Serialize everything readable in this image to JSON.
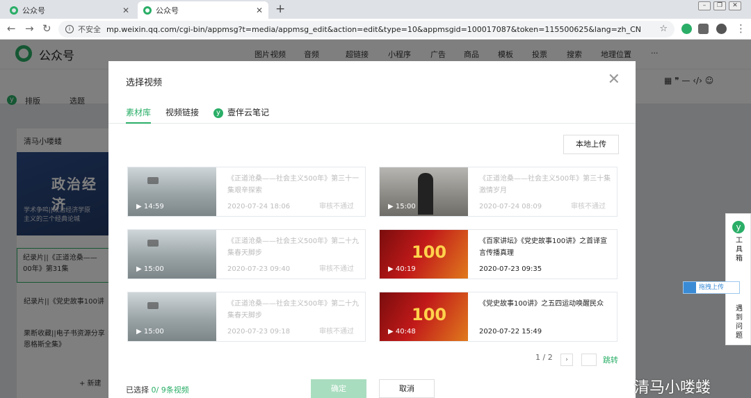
{
  "browser": {
    "tabs": [
      {
        "label": "公众号",
        "close": "✕"
      },
      {
        "label": "公众号",
        "close": "✕"
      }
    ],
    "new_tab": "+",
    "address": {
      "insecure": "不安全",
      "url": "mp.weixin.qq.com/cgi-bin/appmsg?t=media/appmsg_edit&action=edit&type=10&appmsgid=100017087&token=115500625&lang=zh_CN"
    }
  },
  "app": {
    "logo_text": "公众号",
    "toolbar": [
      "图片·",
      "视频",
      "音频",
      "超链接",
      "小程序",
      "广告",
      "商品",
      "模板",
      "投票",
      "搜索",
      "地理位置",
      "···"
    ],
    "editor_tools": [
      "排版",
      "选题"
    ],
    "account": "清马小喽蝼",
    "banner_title": "政治经济",
    "banner_sub": "学术争鸣||政治经济学原\n主义的三个经典论城",
    "articles": [
      "纪录片||《正道沧桑——\n00年》第31集",
      "纪录片||《党史故事100讲",
      "果断收藏||电子书资源分享\n恩格斯全集》"
    ],
    "new_label": "+ 新建"
  },
  "modal": {
    "title": "选择视频",
    "close": "✕",
    "tabs": [
      {
        "label": "素材库",
        "active": true
      },
      {
        "label": "视频链接",
        "active": false
      },
      {
        "label": "壹伴云笔记",
        "active": false
      }
    ],
    "upload_label": "本地上传",
    "videos": [
      {
        "duration": "▶ 14:59",
        "title": "《正道沧桑——社会主义500年》第三十一集艰辛探索",
        "date": "2020-07-24 18:06",
        "status": "审核不通过",
        "thumb": "gray",
        "disabled": true
      },
      {
        "duration": "▶ 15:00",
        "title": "《正道沧桑——社会主义500年》第三十集激情岁月",
        "date": "2020-07-24 08:09",
        "status": "审核不通过",
        "thumb": "person",
        "disabled": true
      },
      {
        "duration": "▶ 15:00",
        "title": "《正道沧桑——社会主义500年》第二十九集春天脚步",
        "date": "2020-07-23 09:40",
        "status": "审核不通过",
        "thumb": "gray",
        "disabled": true
      },
      {
        "duration": "▶ 40:19",
        "title": "《百家讲坛》《党史故事100讲》之首译宣言传播真理",
        "date": "2020-07-23 09:35",
        "status": "",
        "thumb": "red",
        "disabled": false
      },
      {
        "duration": "▶ 15:00",
        "title": "《正道沧桑——社会主义500年》第二十九集春天脚步",
        "date": "2020-07-23 09:18",
        "status": "审核不通过",
        "thumb": "gray",
        "disabled": true
      },
      {
        "duration": "▶ 40:48",
        "title": "《党史故事100讲》之五四运动唤醒民众",
        "date": "2020-07-22 15:49",
        "status": "",
        "thumb": "red",
        "disabled": false
      }
    ],
    "pager": {
      "text": "1 / 2",
      "next": "›",
      "jump": "跳转"
    },
    "selected": {
      "prefix": "已选择",
      "count": "0",
      "suffix": "/ 9条视频"
    },
    "ok_label": "确定",
    "cancel_label": "取消"
  },
  "side": {
    "toolbox": [
      "工",
      "具",
      "箱"
    ],
    "feedback": [
      "遇",
      "到",
      "问",
      "题"
    ],
    "drag_upload": "拖拽上传"
  },
  "watermark": "清马小喽蝼",
  "colors": {
    "accent": "#2aae67",
    "mask": "rgba(0,0,0,0.5)"
  }
}
